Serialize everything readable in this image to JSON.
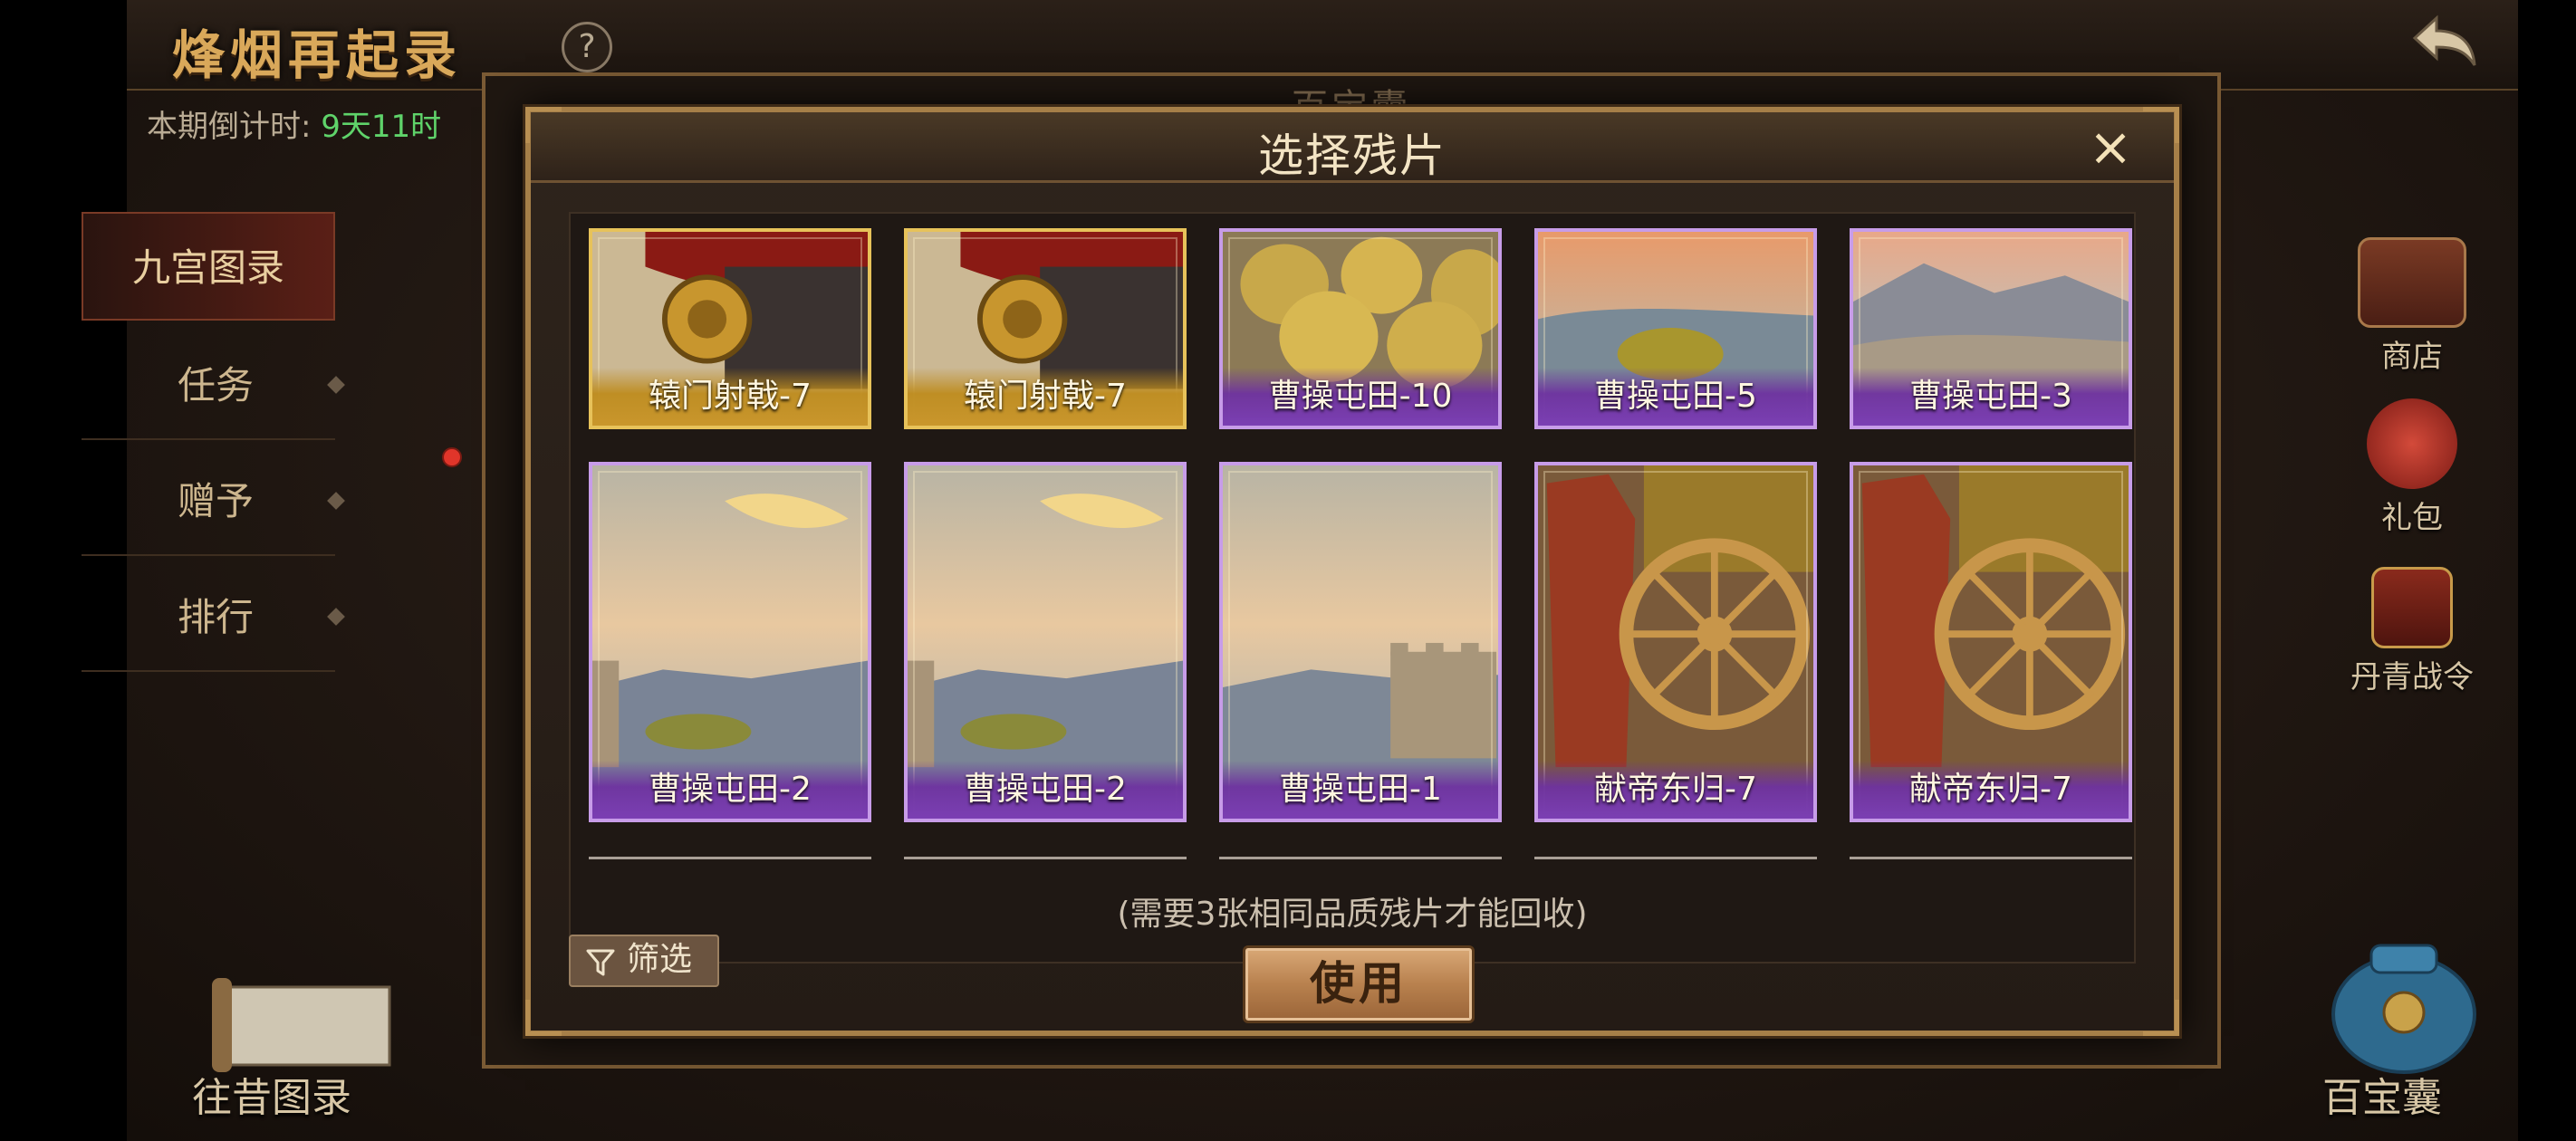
{
  "background": {
    "game_title": "烽烟再起录",
    "help_glyph": "?",
    "countdown_label": "本期倒计时:",
    "countdown_value": "9天11时",
    "underlay_title": "百宝囊",
    "side_tabs": [
      {
        "label": "九宫图录",
        "active": true
      },
      {
        "label": "任务",
        "active": false
      },
      {
        "label": "赠予",
        "active": false,
        "badge": true
      },
      {
        "label": "排行",
        "active": false
      }
    ],
    "right_icons": [
      {
        "label": "商店",
        "icon": "chest-icon"
      },
      {
        "label": "礼包",
        "icon": "gift-icon"
      },
      {
        "label": "丹青战令",
        "icon": "order-icon"
      }
    ],
    "bottom_left_label": "往昔图录",
    "bottom_right_label": "百宝囊"
  },
  "modal": {
    "title": "选择残片",
    "close_glyph": "×",
    "hint": "(需要3张相同品质残片才能回收)",
    "filter_label": "筛选",
    "use_label": "使用",
    "fragments": [
      {
        "label": "辕门射戟-7",
        "quality": "gold",
        "art": "warrior"
      },
      {
        "label": "辕门射戟-7",
        "quality": "gold",
        "art": "warrior"
      },
      {
        "label": "曹操屯田-10",
        "quality": "purple",
        "art": "haystacks"
      },
      {
        "label": "曹操屯田-5",
        "quality": "purple",
        "art": "sunset"
      },
      {
        "label": "曹操屯田-3",
        "quality": "purple",
        "art": "mountains"
      },
      {
        "label": "曹操屯田-2",
        "quality": "purple",
        "art": "sky"
      },
      {
        "label": "曹操屯田-2",
        "quality": "purple",
        "art": "sky"
      },
      {
        "label": "曹操屯田-1",
        "quality": "purple",
        "art": "wall"
      },
      {
        "label": "献帝东归-7",
        "quality": "purple",
        "art": "chariot"
      },
      {
        "label": "献帝东归-7",
        "quality": "purple",
        "art": "chariot"
      }
    ]
  }
}
